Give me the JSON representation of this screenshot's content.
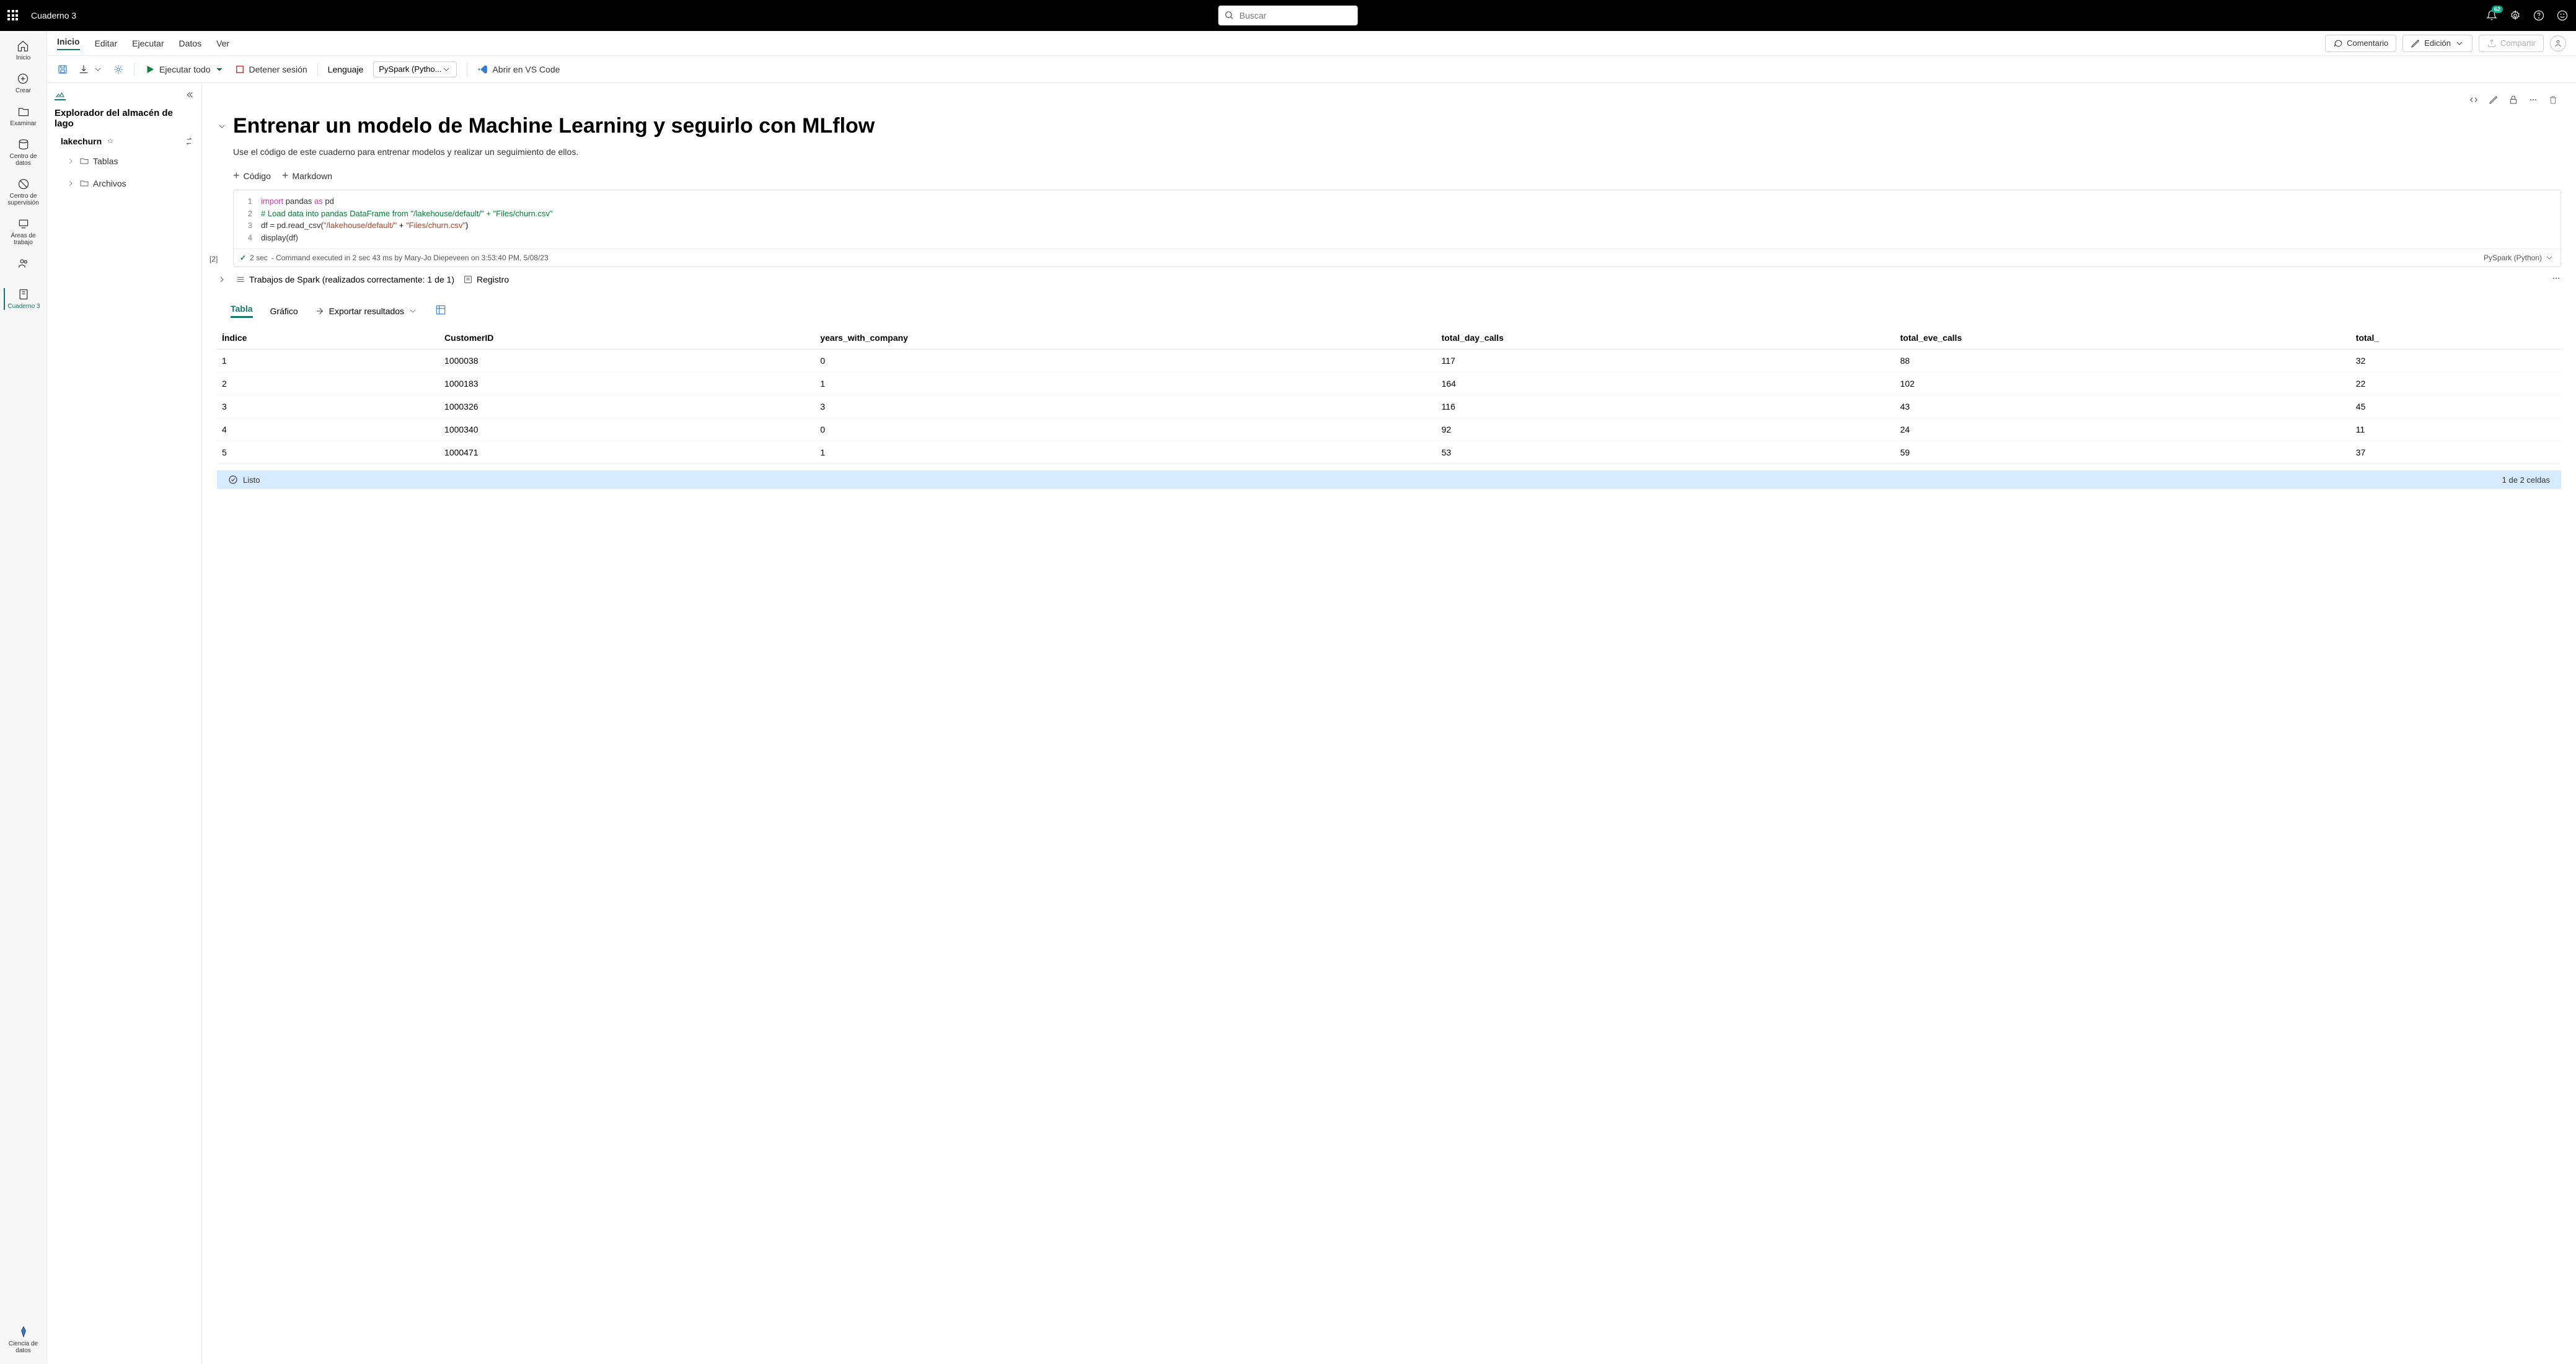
{
  "topbar": {
    "breadcrumb": "Cuaderno 3",
    "search_placeholder": "Buscar",
    "notification_count": "62"
  },
  "leftnav": {
    "items": [
      "Inicio",
      "Crear",
      "Examinar",
      "Centro de datos",
      "Centro de supervisión",
      "Áreas de trabajo"
    ],
    "active": "Cuaderno 3",
    "bottom": "Ciencia de datos"
  },
  "menubar": {
    "items": [
      "Inicio",
      "Editar",
      "Ejecutar",
      "Datos",
      "Ver"
    ],
    "comment": "Comentario",
    "edit": "Edición",
    "share": "Compartir"
  },
  "toolbar": {
    "run_all": "Ejecutar todo",
    "stop": "Detener sesión",
    "lang_label": "Lenguaje",
    "lang_value": "PySpark (Pytho...",
    "vscode": "Abrir en VS Code"
  },
  "explorer": {
    "title": "Explorador del almacén de lago",
    "lake": "lakechurn",
    "tree": [
      "Tablas",
      "Archivos"
    ]
  },
  "notebook": {
    "title": "Entrenar un modelo de Machine Learning y seguirlo con MLflow",
    "desc": "Use el código de este cuaderno para entrenar modelos y realizar un seguimiento de ellos.",
    "insert_code": "Código",
    "insert_md": "Markdown",
    "exec_label": "[2]",
    "code": {
      "l1a": "import",
      "l1b": "pandas",
      "l1c": "as",
      "l1d": "pd",
      "l2": "# Load data into pandas DataFrame from \"/lakehouse/default/\" + \"Files/churn.csv\"",
      "l3a": "df = pd.read_csv(",
      "l3b": "\"/lakehouse/default/\"",
      "l3c": " + ",
      "l3d": "\"Files/churn.csv\"",
      "l3e": ")",
      "l4": "display(df)"
    },
    "status_time": "2 sec",
    "status_msg": "- Command executed in 2 sec 43 ms by Mary-Jo Diepeveen on 3:53:40 PM, 5/08/23",
    "lang_status": "PySpark (Python)",
    "spark_jobs": "Trabajos de Spark (realizados correctamente: 1 de 1)",
    "log": "Registro",
    "results": {
      "tabs": {
        "table": "Tabla",
        "chart": "Gráfico",
        "export": "Exportar resultados"
      },
      "headers": [
        "Índice",
        "CustomerID",
        "years_with_company",
        "total_day_calls",
        "total_eve_calls",
        "total_"
      ],
      "rows": [
        [
          "1",
          "1000038",
          "0",
          "117",
          "88",
          "32"
        ],
        [
          "2",
          "1000183",
          "1",
          "164",
          "102",
          "22"
        ],
        [
          "3",
          "1000326",
          "3",
          "116",
          "43",
          "45"
        ],
        [
          "4",
          "1000340",
          "0",
          "92",
          "24",
          "11"
        ],
        [
          "5",
          "1000471",
          "1",
          "53",
          "59",
          "37"
        ]
      ]
    }
  },
  "statusbar": {
    "ready": "Listo",
    "cells": "1 de 2 celdas"
  }
}
